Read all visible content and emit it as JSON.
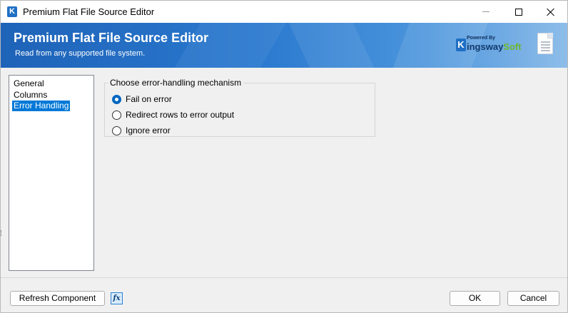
{
  "window": {
    "title": "Premium Flat File Source Editor",
    "app_icon_letter": "K"
  },
  "banner": {
    "title": "Premium Flat File Source Editor",
    "subtitle": "Read from any supported file system.",
    "powered_by": "Powered By",
    "brand_letter": "K",
    "brand_kingsway": "ingsway",
    "brand_soft": "Soft"
  },
  "nav": {
    "items": [
      {
        "label": "General"
      },
      {
        "label": "Columns"
      },
      {
        "label": "Error Handling",
        "selected": true
      }
    ]
  },
  "error_handling": {
    "legend": "Choose error-handling mechanism",
    "options": [
      {
        "label": "Fail on error",
        "checked": true
      },
      {
        "label": "Redirect rows to error output",
        "checked": false
      },
      {
        "label": "Ignore error",
        "checked": false
      }
    ]
  },
  "footer": {
    "refresh_label": "Refresh Component",
    "fx_label": "fx",
    "ok_label": "OK",
    "cancel_label": "Cancel"
  },
  "colors": {
    "banner_start": "#1e63b8",
    "banner_end": "#8ebde9",
    "selection": "#0078d7",
    "radio_checked": "#0067c0",
    "brand_green": "#6fb62f"
  }
}
